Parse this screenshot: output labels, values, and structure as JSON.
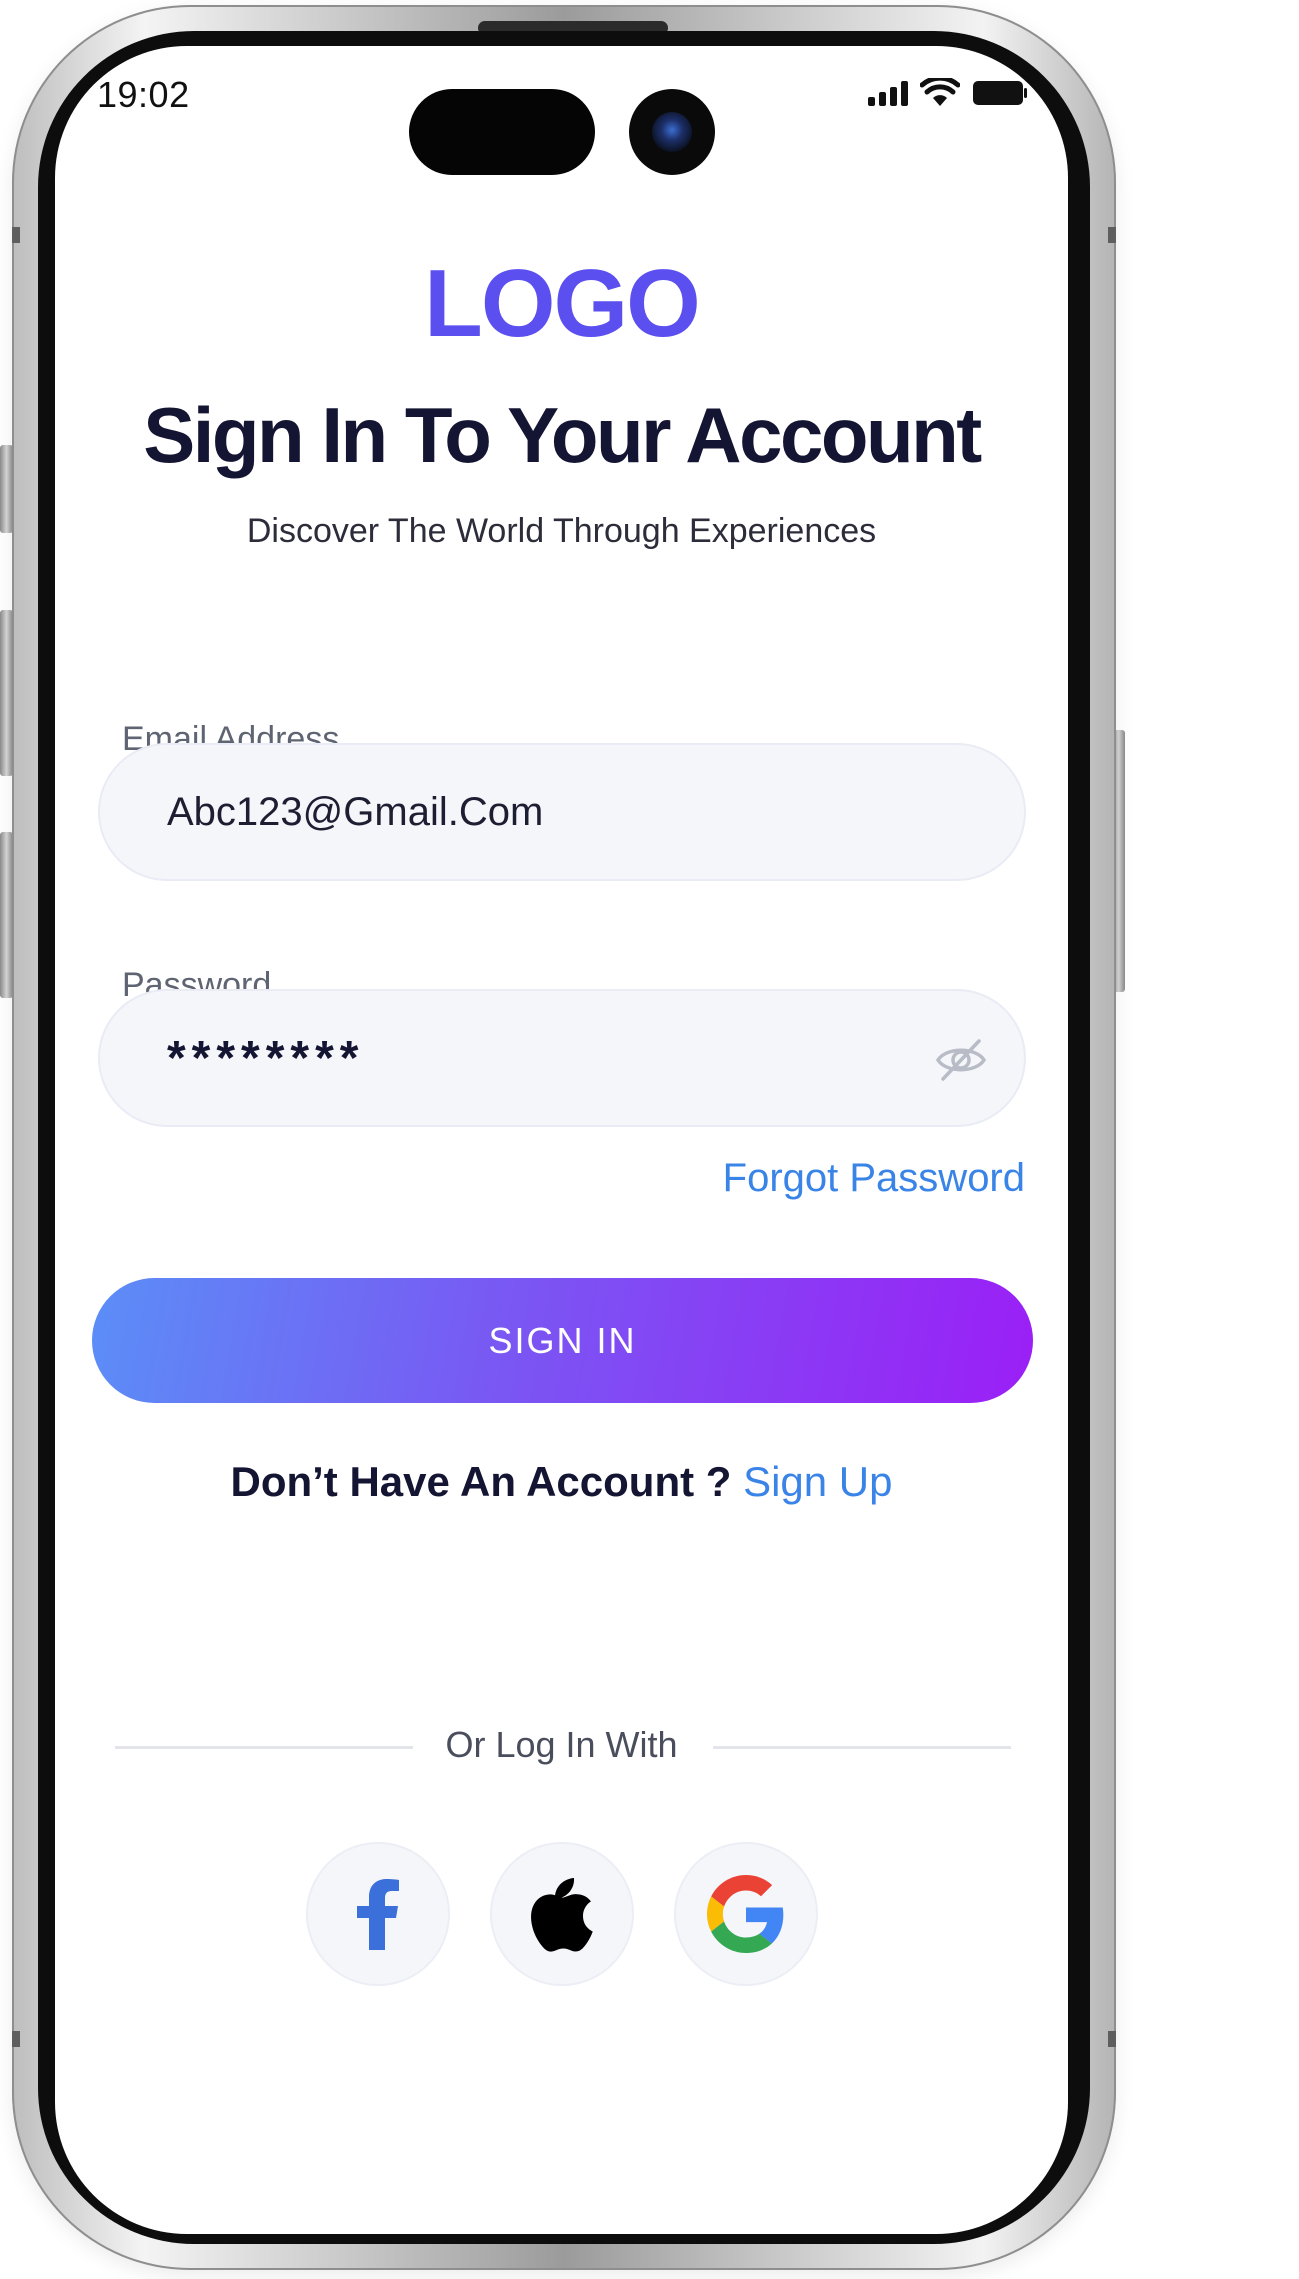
{
  "status_bar": {
    "time": "19:02"
  },
  "brand": {
    "logo_text": "LOGO",
    "accent_color": "#5b4ff0"
  },
  "header": {
    "title": "Sign In To Your Account",
    "subtitle": "Discover The World Through Experiences"
  },
  "form": {
    "email": {
      "label": "Email Address",
      "value": "Abc123@Gmail.Com"
    },
    "password": {
      "label": "Password",
      "masked_value": "********",
      "toggle_icon": "eye-off-icon"
    },
    "forgot_password_label": "Forgot Password",
    "submit_label": "SIGN IN",
    "submit_gradient": [
      "#5b8ef7",
      "#7a56f3",
      "#9b1ff6"
    ]
  },
  "signup": {
    "prompt": "Don’t Have An Account ?",
    "link_label": "Sign Up",
    "link_color": "#3a84e8"
  },
  "social": {
    "divider_label": "Or Log In With",
    "providers": [
      {
        "name": "facebook",
        "icon": "facebook-icon",
        "color": "#3b6fd9"
      },
      {
        "name": "apple",
        "icon": "apple-icon",
        "color": "#000000"
      },
      {
        "name": "google",
        "icon": "google-icon",
        "color": "#4285f4"
      }
    ]
  }
}
